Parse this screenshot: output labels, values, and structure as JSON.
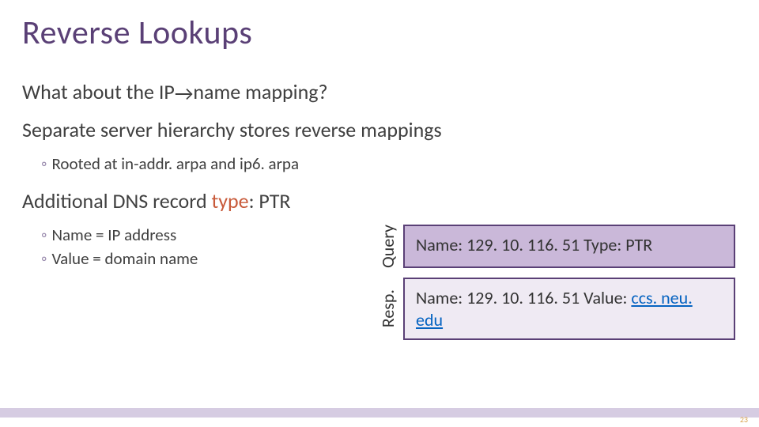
{
  "title": "Reverse Lookups",
  "lines": {
    "q1_pre": "What about the IP",
    "q1_post": "name mapping?",
    "l2": "Separate server hierarchy stores reverse mappings",
    "l2_sub": "Rooted at in-addr. arpa and ip6. arpa",
    "l3_pre": "Additional DNS record ",
    "l3_accent": "type",
    "l3_post": ": PTR",
    "l3_sub1": "Name = IP address",
    "l3_sub2": "Value = domain name"
  },
  "query": {
    "label": "Query",
    "text": "Name: 129. 10. 116. 51 Type: PTR"
  },
  "resp": {
    "label": "Resp.",
    "text_pre": "Name: 129. 10. 116. 51 Value: ",
    "link": "ccs. neu. edu"
  },
  "pagenum": "23",
  "glyphs": {
    "arrow": "→",
    "bullet": "◦"
  }
}
